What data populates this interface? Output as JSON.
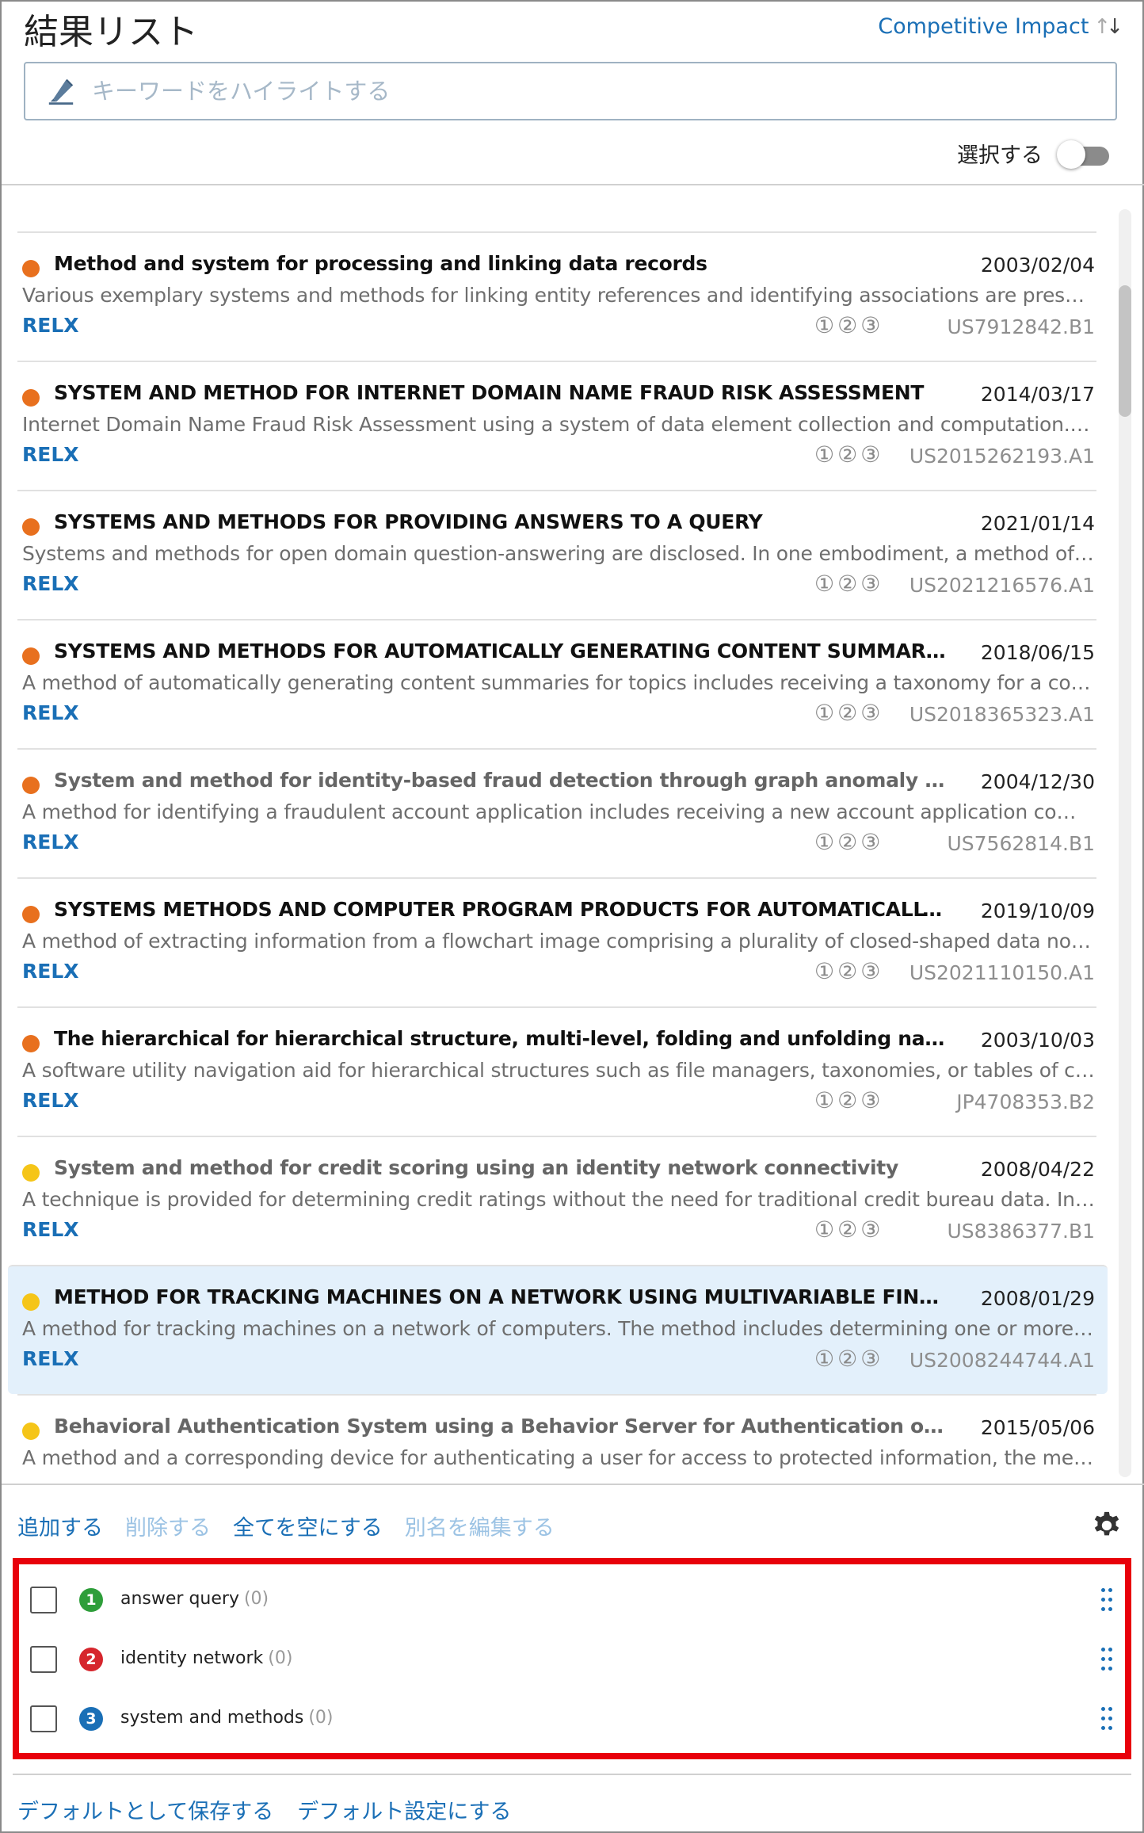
{
  "header": {
    "title": "結果リスト",
    "sort_label": "Competitive Impact",
    "sort_icon": "sort-arrows-icon",
    "search_placeholder": "キーワードをハイライトする",
    "select_label": "選択する",
    "select_toggle_on": false
  },
  "colors": {
    "accent": "#1a6fb6",
    "orange_dot": "#e8701e",
    "yellow_dot": "#f5c518",
    "selected_bg": "#e3f0fb",
    "highlight_border": "#e8000b",
    "badge_green": "#2e9e3a",
    "badge_red": "#d6262d",
    "badge_blue": "#1a6fb6"
  },
  "results": [
    {
      "dot": "orange",
      "title": "Method and system for processing and linking data records",
      "date": "2003/02/04",
      "abstract": "Various exemplary systems and methods for linking entity references and identifying associations are presented. In one exemplary implementation, a system is described",
      "assignee": "RELX",
      "markers": "①②③",
      "pub": "US7912842.B1"
    },
    {
      "dot": "orange",
      "title": "SYSTEM AND METHOD FOR INTERNET DOMAIN NAME FRAUD RISK ASSESSMENT",
      "date": "2014/03/17",
      "abstract": "Internet Domain Name Fraud Risk Assessment using a system of data element collection and computation. Data elements are collected",
      "assignee": "RELX",
      "markers": "①②③",
      "pub": "US2015262193.A1"
    },
    {
      "dot": "orange",
      "title": "SYSTEMS AND METHODS FOR PROVIDING ANSWERS TO A QUERY",
      "date": "2021/01/14",
      "abstract": "Systems and methods for open domain question-answering are disclosed. In one embodiment, a method of providing answers to a query",
      "assignee": "RELX",
      "markers": "①②③",
      "pub": "US2021216576.A1"
    },
    {
      "dot": "orange",
      "title": "SYSTEMS AND METHODS FOR AUTOMATICALLY GENERATING CONTENT SUMMARIES FOR TOPICS",
      "date": "2018/06/15",
      "abstract": "A method of automatically generating content summaries for topics includes receiving a taxonomy for a concept and a plurality of documents",
      "assignee": "RELX",
      "markers": "①②③",
      "pub": "US2018365323.A1"
    },
    {
      "dot": "orange",
      "title": "System and method for identity-based fraud detection through graph anomaly detection",
      "date": "2004/12/30",
      "abstract": "A method for identifying a fraudulent account application includes receiving a new account application comprising a plurality of fields",
      "assignee": "RELX",
      "markers": "①②③",
      "pub": "US7562814.B1",
      "dim": true
    },
    {
      "dot": "orange",
      "title": "SYSTEMS METHODS AND COMPUTER PROGRAM PRODUCTS FOR AUTOMATICALLY EXTRACTING INFORMATION",
      "date": "2019/10/09",
      "abstract": "A method of extracting information from a flowchart image comprising a plurality of closed-shaped data nodes having text",
      "assignee": "RELX",
      "markers": "①②③",
      "pub": "US2021110150.A1"
    },
    {
      "dot": "orange",
      "title": "The hierarchical for hierarchical structure, multi-level, folding and unfolding navigation support",
      "date": "2003/10/03",
      "abstract": "A software utility navigation aid for hierarchical structures such as file managers, taxonomies, or tables of contents that",
      "assignee": "RELX",
      "markers": "①②③",
      "pub": "JP4708353.B2"
    },
    {
      "dot": "yellow",
      "title": "System and method for credit scoring using an identity network connectivity",
      "date": "2008/04/22",
      "abstract": "A technique is provided for determining credit ratings without the need for traditional credit bureau data. In at least one embodiment",
      "assignee": "RELX",
      "markers": "①②③",
      "pub": "US8386377.B1",
      "dim": true
    },
    {
      "dot": "yellow",
      "title": "METHOD FOR TRACKING MACHINES ON A NETWORK USING MULTIVARIABLE FINGERPRINTING",
      "date": "2008/01/29",
      "abstract": "A method for tracking machines on a network of computers. The method includes determining one or more assertions",
      "assignee": "RELX",
      "markers": "①②③",
      "pub": "US2008244744.A1",
      "selected": true
    },
    {
      "dot": "yellow",
      "title": "Behavioral Authentication System using a Behavior Server for Authentication of Multiple Users",
      "date": "2015/05/06",
      "abstract": "A method and a corresponding device for authenticating a user for access to protected information, the method comprising",
      "assignee": "",
      "markers": "",
      "pub": "",
      "dim": true
    }
  ],
  "actions": {
    "add": "追加する",
    "delete": "削除する",
    "clear_all": "全てを空にする",
    "edit_alias": "別名を編集する",
    "settings_icon": "gear-icon"
  },
  "keywords": [
    {
      "num": "1",
      "color": "green",
      "label": "answer query",
      "count": "(0)"
    },
    {
      "num": "2",
      "color": "red",
      "label": "identity network",
      "count": "(0)"
    },
    {
      "num": "3",
      "color": "blue",
      "label": "system and methods",
      "count": "(0)"
    }
  ],
  "footer": {
    "save_default": "デフォルトとして保存する",
    "set_default": "デフォルト設定にする"
  }
}
